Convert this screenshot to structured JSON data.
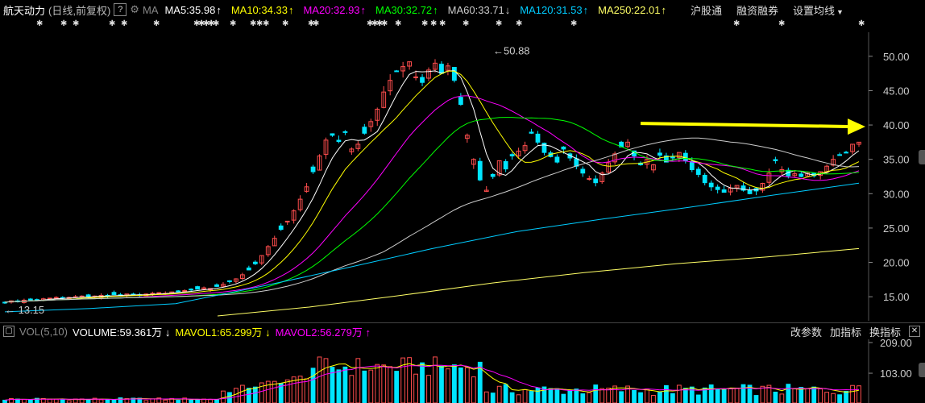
{
  "header": {
    "stock_name": "航天动力",
    "mode": "(日线,前复权)",
    "help": "?",
    "ma_label": "MA",
    "ma_items": [
      {
        "label": "MA5:35.98",
        "arrow": "↑",
        "color": "#ffffff"
      },
      {
        "label": "MA10:34.33",
        "arrow": "↑",
        "color": "#ffff00"
      },
      {
        "label": "MA20:32.93",
        "arrow": "↑",
        "color": "#ff00ff"
      },
      {
        "label": "MA30:32.72",
        "arrow": "↑",
        "color": "#00ff00"
      },
      {
        "label": "MA60:33.71",
        "arrow": "↓",
        "color": "#cccccc"
      },
      {
        "label": "MA120:31.53",
        "arrow": "↑",
        "color": "#00ccff"
      },
      {
        "label": "MA250:22.01",
        "arrow": "↑",
        "color": "#ffff66"
      }
    ],
    "links": [
      "沪股通",
      "融资融券",
      "设置均线"
    ]
  },
  "marker_symbol": "✱",
  "price_axis": {
    "ticks": [
      "50.00",
      "45.00",
      "40.00",
      "35.00",
      "30.00",
      "25.00",
      "20.00",
      "15.00"
    ],
    "min": 11.5,
    "max": 53.5
  },
  "annotations": {
    "high_label": "←50.88",
    "low_label": "← 13.15"
  },
  "chart_data": {
    "type": "candlestick",
    "high": 50.88,
    "low": 13.15,
    "closes": [
      14.2,
      14.4,
      14.3,
      14.5,
      14.6,
      14.5,
      14.7,
      14.8,
      14.9,
      14.8,
      14.9,
      15.0,
      15.1,
      15.0,
      15.1,
      15.2,
      15.1,
      15.3,
      15.2,
      15.4,
      15.3,
      15.2,
      15.4,
      15.5,
      15.6,
      15.5,
      15.7,
      15.8,
      15.9,
      16.0,
      16.1,
      16.3,
      16.2,
      16.5,
      16.8,
      17.2,
      17.6,
      18.2,
      18.9,
      19.8,
      21.0,
      22.3,
      23.5,
      24.8,
      26.0,
      27.5,
      29.2,
      31.0,
      33.2,
      35.5,
      37.8,
      38.5,
      37.6,
      39.0,
      36.5,
      37.2,
      38.8,
      40.5,
      42.3,
      44.8,
      46.5,
      47.8,
      48.5,
      49.2,
      47.0,
      46.2,
      48.0,
      49.0,
      47.5,
      48.6,
      46.5,
      43.0,
      38.5,
      35.0,
      32.0,
      30.5,
      32.5,
      34.8,
      33.6,
      35.5,
      36.2,
      37.0,
      38.8,
      37.5,
      36.0,
      35.4,
      34.6,
      36.5,
      35.2,
      34.0,
      33.0,
      32.2,
      31.6,
      33.0,
      34.5,
      35.8,
      36.8,
      37.5,
      35.5,
      34.2,
      35.0,
      34.2,
      35.6,
      34.6,
      35.2,
      36.0,
      34.8,
      33.5,
      32.8,
      31.6,
      31.0,
      30.6,
      30.2,
      30.8,
      31.2,
      30.5,
      30.0,
      30.4,
      31.5,
      33.0,
      34.8,
      33.5,
      32.6,
      32.9,
      32.5,
      33.0,
      32.6,
      33.2,
      34.0,
      35.0,
      35.6,
      36.0,
      37.2,
      37.5
    ],
    "ma": [
      {
        "name": "MA5",
        "color": "#ffffff"
      },
      {
        "name": "MA10",
        "color": "#ffff00"
      },
      {
        "name": "MA20",
        "color": "#ff00ff"
      },
      {
        "name": "MA30",
        "color": "#00ff00"
      },
      {
        "name": "MA60",
        "color": "#cccccc"
      },
      {
        "name": "MA120",
        "color": "#00ccff"
      },
      {
        "name": "MA250",
        "color": "#ffff66"
      }
    ],
    "ma250_start": 22.01,
    "ma250_values": [
      12.2,
      13.5,
      15.2,
      17.0,
      18.5,
      19.8,
      20.8,
      22.01
    ],
    "ma120_values": [
      12.8,
      13.3,
      14.0,
      16.5,
      19.2,
      22.0,
      24.5,
      26.3,
      28.0,
      29.8,
      31.53
    ],
    "annotation_arrow": {
      "from": 40.0,
      "to": 40.0,
      "color": "#ffff00"
    }
  },
  "volume": {
    "box": "▢",
    "title": "VOL(5,10)",
    "items": [
      {
        "label": "VOLUME:59.361万",
        "arrow": "↓",
        "color": "#ffffff"
      },
      {
        "label": "MAVOL1:65.299万",
        "arrow": "↓",
        "color": "#ffff00"
      },
      {
        "label": "MAVOL2:56.279万",
        "arrow": "↑",
        "color": "#ff00ff"
      }
    ],
    "right_links": [
      "改参数",
      "加指标",
      "换指标"
    ],
    "close": "✕",
    "axis_ticks": [
      "209.00",
      "103.00"
    ],
    "max": 209
  }
}
